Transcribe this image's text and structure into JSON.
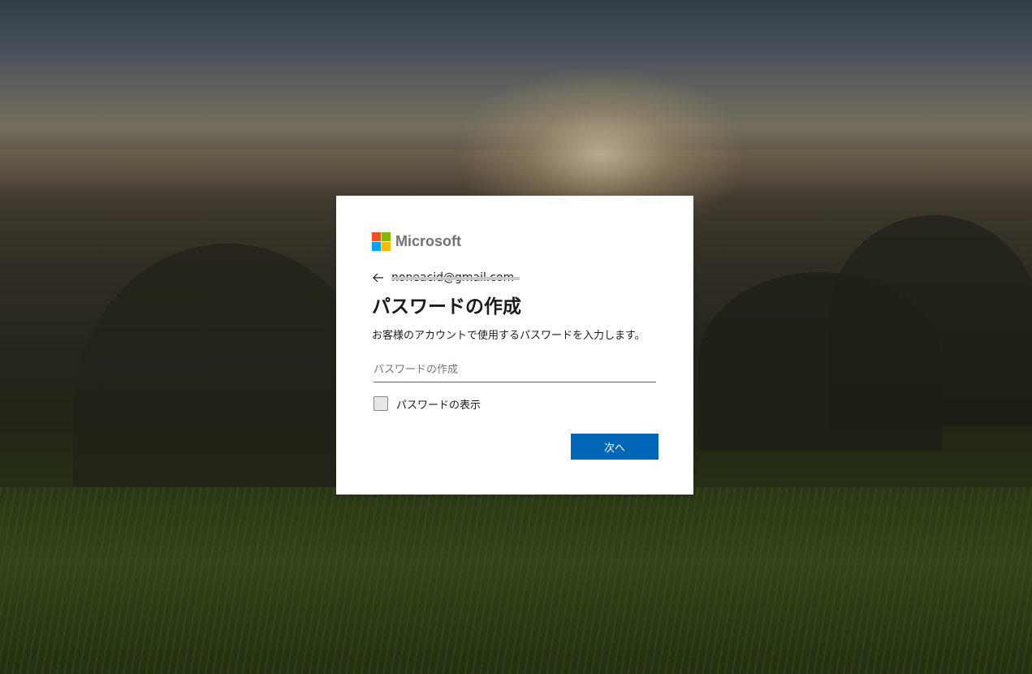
{
  "brand": {
    "name": "Microsoft",
    "logo_colors": [
      "#f25022",
      "#7fba00",
      "#00a4ef",
      "#ffb900"
    ]
  },
  "identity": {
    "back_icon": "back-arrow-icon",
    "email": "noneacid@gmail.com"
  },
  "page": {
    "title": "パスワードの作成",
    "description": "お客様のアカウントで使用するパスワードを入力します。"
  },
  "form": {
    "password_placeholder": "パスワードの作成",
    "password_value": "",
    "show_password_label": "パスワードの表示",
    "show_password_checked": false,
    "next_label": "次へ"
  },
  "colors": {
    "accent": "#0067b8",
    "text": "#1b1b1b",
    "brand_text": "#737373"
  }
}
